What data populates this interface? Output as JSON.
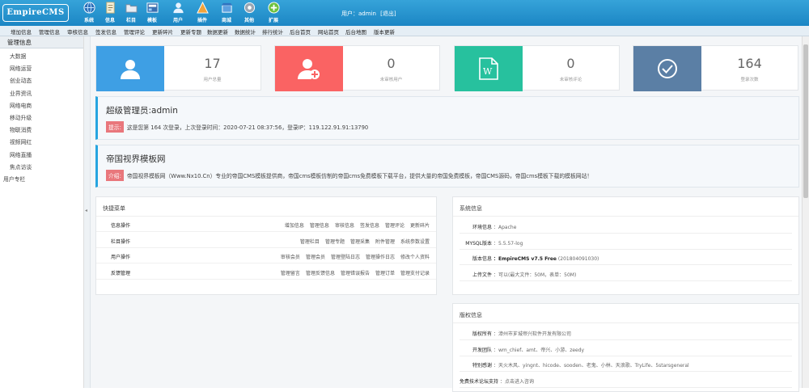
{
  "logo_text": "EmpireCMS",
  "top_nav": [
    {
      "label": "系统",
      "icon": "globe-icon"
    },
    {
      "label": "信息",
      "icon": "document-icon"
    },
    {
      "label": "栏目",
      "icon": "folder-icon"
    },
    {
      "label": "模板",
      "icon": "template-icon"
    },
    {
      "label": "用户",
      "icon": "user-icon"
    },
    {
      "label": "插件",
      "icon": "plugin-icon"
    },
    {
      "label": "商城",
      "icon": "shop-icon"
    },
    {
      "label": "其他",
      "icon": "gear-icon"
    },
    {
      "label": "扩展",
      "icon": "plus-icon"
    }
  ],
  "user_info": {
    "prefix": "用户：admin",
    "logout": "[退出]"
  },
  "sub_nav": [
    "增加信息",
    "管理信息",
    "审核信息",
    "签发信息",
    "管理评论",
    "更新碎片",
    "更新专题",
    "数据更新",
    "数据统计",
    "排行统计",
    "后台首页",
    "网站首页",
    "后台地图",
    "版本更新"
  ],
  "sidebar": {
    "header": "管理信息",
    "items": [
      "大数据",
      "网络运营",
      "创业动态",
      "业界资讯",
      "网络电商",
      "移动升级",
      "物联消费",
      "视频网红",
      "网络直播",
      "焦点访谈"
    ],
    "footer": "用户专栏"
  },
  "stats": [
    {
      "value": "17",
      "label": "用户总量",
      "color": "#3e9fe4",
      "icon": "user-icon"
    },
    {
      "value": "0",
      "label": "未审核用户",
      "color": "#fa6363",
      "icon": "user-add-icon"
    },
    {
      "value": "0",
      "label": "未审核评论",
      "color": "#27c19e",
      "icon": "word-doc-icon"
    },
    {
      "value": "164",
      "label": "登录次数",
      "color": "#5b7fa5",
      "icon": "check-circle-icon"
    }
  ],
  "admin_panel": {
    "title": "超级管理员:admin",
    "tag": "提示:",
    "text": "这是您第 164 次登录，上次登录时间：2020-07-21 08:37:56，登录IP：119.122.91.91:13790"
  },
  "site_panel": {
    "title": "帝国视界模板网",
    "tag": "介绍:",
    "text": "帝国视界模板网（Www.Nx10.Cn）专业的帝国CMS模板提供商，帝国cms模板仿制的帝国cms免费模板下载平台，提供大量的帝国免费模板，帝国CMS源码，帝国cms模板下载的模板网站！"
  },
  "quick_menu": {
    "title": "快捷菜单",
    "rows": [
      {
        "label": "信息操作",
        "links": [
          "增加信息",
          "管理信息",
          "审核信息",
          "签发信息",
          "管理评论",
          "更新碎片"
        ]
      },
      {
        "label": "栏目操作",
        "links": [
          "管理栏目",
          "管理专题",
          "管理采集",
          "附件管理",
          "系统参数设置"
        ]
      },
      {
        "label": "用户操作",
        "links": [
          "审核会员",
          "管理会员",
          "管理登陆日志",
          "管理操作日志",
          "修改个人资料"
        ]
      },
      {
        "label": "反馈管理",
        "links": [
          "管理留言",
          "管理反馈信息",
          "管理错误报告",
          "管理订单",
          "管理支付记录"
        ]
      }
    ]
  },
  "system_info": {
    "title": "系统信息",
    "rows": [
      {
        "key": "环境信息",
        "value": "Apache",
        "bold": false
      },
      {
        "key": "MYSQL版本",
        "value": "5.5.57-log",
        "bold": false
      },
      {
        "key": "版本信息",
        "value": "EmpireCMS v7.5 Free",
        "extra": "(201804091030)",
        "bold": true
      },
      {
        "key": "上传文件",
        "value": "可以(最大文件：50M，表单：50M)",
        "bold": false
      }
    ]
  },
  "copyright": {
    "title": "版权信息",
    "rows": [
      {
        "key": "版权所有",
        "value": "漳州市芗城帝兴软件开发有限公司"
      },
      {
        "key": "开发团队",
        "value": "wm_chief、amt、帝兴、小游、zeedy"
      },
      {
        "key": "特别感谢",
        "value": "天火木风、yingnt、hicode、sooden、老鬼、小林、天浪歌、TryLife、5starsgeneral"
      },
      {
        "key": "免费技术论坛支持",
        "value": "点击进入咨询"
      }
    ]
  },
  "user_info_sep": "："
}
